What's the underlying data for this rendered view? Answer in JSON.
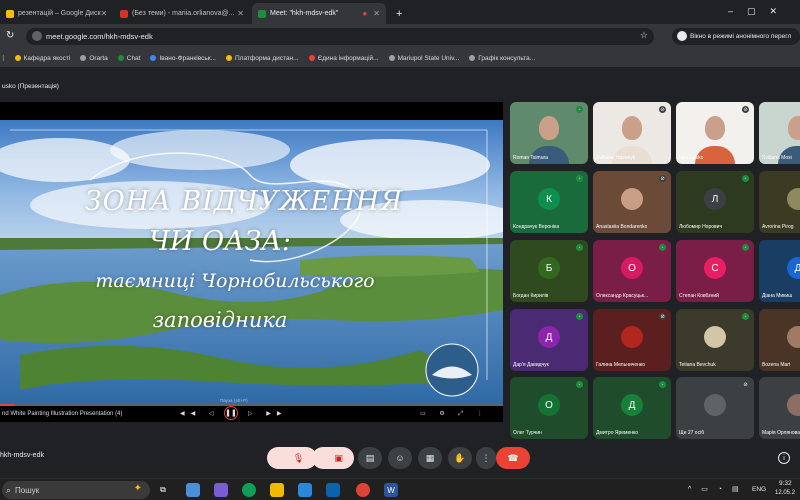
{
  "browser": {
    "tabs": [
      {
        "title": "резентацій – Google Диск",
        "color": "#fbbc04"
      },
      {
        "title": "(Без теми) - mariia.orlianova@...",
        "color": "#d93025"
      },
      {
        "title": "Meet: \"hkh-mdsv-edk\"",
        "color": "#1e8e3e"
      }
    ],
    "new_tab": "+",
    "url": "meet.google.com/hkh-mdsv-edk",
    "incognito_label": "Вікно в режимі анонімного перегл",
    "bookmarks": [
      {
        "label": "Кафедра якості",
        "color": "#fbbc04"
      },
      {
        "label": "Orarta",
        "color": "#9aa0a6"
      },
      {
        "label": "Chat",
        "color": "#1e8e3e"
      },
      {
        "label": "Івано-Франківськ...",
        "color": "#4285f4"
      },
      {
        "label": "Платформа дистан...",
        "color": "#fbbc04"
      },
      {
        "label": "Єдина інформацій...",
        "color": "#ea4335"
      },
      {
        "label": "Mariupol State Univ...",
        "color": "#9aa0a6"
      },
      {
        "label": "Графік консульта...",
        "color": "#9aa0a6"
      }
    ]
  },
  "meet": {
    "presenter_label": "usko (Презентація)",
    "meeting_code": "hkh-mdsv-edk",
    "slide": {
      "line1": "ЗОНА ВІДЧУЖЕННЯ",
      "line2": "ЧИ ОАЗА:",
      "line3": "таємниці Чорнобильського",
      "line4": "заповідника"
    },
    "player": {
      "filename": "nd White Painting Illustration Presentation (4)",
      "tooltip": "Пауза (Alt+P)"
    },
    "participants": [
      {
        "name": "Roman Tsimura",
        "initial": "",
        "bg": "#5f8a6b",
        "mic": true,
        "photo": true
      },
      {
        "name": "Svitlana Yatsenyk",
        "initial": "",
        "bg": "#ece9e4",
        "mic": false,
        "photo": true
      },
      {
        "name": "Iulia Kusko",
        "initial": "",
        "bg": "#f3f1ee",
        "mic": false,
        "photo": true
      },
      {
        "name": "Svitlana Mosi",
        "initial": "",
        "bg": "#c8d6cf",
        "mic": false,
        "photo": true
      },
      {
        "name": "Кондрачук Вероніка",
        "initial": "К",
        "bg": "#1a6b3c",
        "avbg": "#0d904f",
        "mic": true
      },
      {
        "name": "Anastasiia Bondarenko",
        "initial": "",
        "bg": "#6b4a38",
        "avbg": "#c89f86",
        "mic": false
      },
      {
        "name": "Любомир Норович",
        "initial": "Л",
        "bg": "#2d3a1f",
        "avbg": "#3c4043",
        "mic": true
      },
      {
        "name": "Avrorina Pirog",
        "initial": "",
        "bg": "#3b3a22",
        "avbg": "#8d8a5f",
        "mic": true
      },
      {
        "name": "Богдан Кирилів",
        "initial": "Б",
        "bg": "#2e4a1e",
        "avbg": "#33691e",
        "mic": true
      },
      {
        "name": "Олександр Красуцьк...",
        "initial": "О",
        "bg": "#7a1e48",
        "avbg": "#d81b60",
        "mic": true
      },
      {
        "name": "Степан Ковбзний",
        "initial": "С",
        "bg": "#7a1e48",
        "avbg": "#e91e63",
        "mic": true
      },
      {
        "name": "Діана Микиш",
        "initial": "Д",
        "bg": "#1a3d63",
        "avbg": "#1967d2",
        "mic": true
      },
      {
        "name": "Дар'я Давидчук",
        "initial": "Д",
        "bg": "#4a2a72",
        "avbg": "#8e24aa",
        "mic": true
      },
      {
        "name": "Галина Мельниченко",
        "initial": "",
        "bg": "#5b1f1f",
        "avbg": "#b3261e",
        "mic": false
      },
      {
        "name": "Tetiana Bevchuk",
        "initial": "",
        "bg": "#3c3a2a",
        "avbg": "#d2c5a8",
        "mic": true
      },
      {
        "name": "Bozena Mart",
        "initial": "",
        "bg": "#4a3426",
        "avbg": "#a07a62",
        "mic": true
      },
      {
        "name": "Олег Турчин",
        "initial": "О",
        "bg": "#1f4d2c",
        "avbg": "#137333",
        "mic": true
      },
      {
        "name": "Дмитро Яременко",
        "initial": "Д",
        "bg": "#1f4d2c",
        "avbg": "#188038",
        "mic": true
      },
      {
        "name": "Ще 27 осіб",
        "initial": "",
        "bg": "#3c4043",
        "avbg": "#5f6368",
        "mic": false
      },
      {
        "name": "Марія Орлянова",
        "initial": "",
        "bg": "#3c4043",
        "avbg": "#8d6e63",
        "mic": false
      }
    ]
  },
  "taskbar": {
    "search_placeholder": "Пошук",
    "lang": "ENG",
    "time": "9:32",
    "date": "12.05.2"
  }
}
